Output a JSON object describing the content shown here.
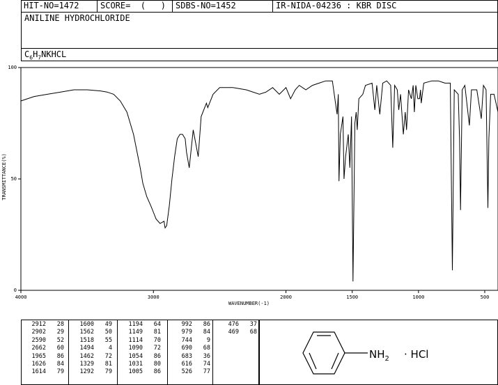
{
  "header": {
    "hit_no": "HIT-NO=1472",
    "score": "SCORE=  (   )",
    "sdbs_no": "SDBS-NO=1452",
    "ir_code": "IR-NIDA-04236 : KBR DISC"
  },
  "compound": {
    "name": "ANILINE HYDROCHLORIDE",
    "formula_prefix": "C",
    "formula_c_count": "6",
    "formula_h": "H",
    "formula_h_count": "7",
    "formula_suffix": "NKHCL"
  },
  "structure": {
    "amine": "NH",
    "amine_sub": "2",
    "salt": "· HCl"
  },
  "chart_data": {
    "type": "line",
    "xlabel": "WAVENUMBER(-1)",
    "ylabel": "TRANSMITTANCE(%)",
    "xlim": [
      4000,
      400
    ],
    "ylim": [
      0,
      100
    ],
    "x_ticks": [
      4000,
      3000,
      2000,
      1500,
      1000,
      500
    ],
    "y_ticks": [
      0,
      50,
      100
    ],
    "x_tick_labels": [
      "4000",
      "3000",
      "2000",
      "1500",
      "1000",
      "500"
    ],
    "y_tick_labels": [
      "0",
      "50",
      "100"
    ],
    "grid": false,
    "series": [
      {
        "points": [
          [
            4000,
            85
          ],
          [
            3900,
            87
          ],
          [
            3800,
            88
          ],
          [
            3700,
            89
          ],
          [
            3600,
            90
          ],
          [
            3500,
            90
          ],
          [
            3400,
            89.5
          ],
          [
            3350,
            89
          ],
          [
            3300,
            88
          ],
          [
            3250,
            85
          ],
          [
            3200,
            80
          ],
          [
            3150,
            70
          ],
          [
            3100,
            55
          ],
          [
            3080,
            48
          ],
          [
            3050,
            42
          ],
          [
            3020,
            38
          ],
          [
            3000,
            35
          ],
          [
            2980,
            32
          ],
          [
            2950,
            30
          ],
          [
            2920,
            31
          ],
          [
            2912,
            28
          ],
          [
            2900,
            29
          ],
          [
            2880,
            38
          ],
          [
            2860,
            50
          ],
          [
            2840,
            60
          ],
          [
            2820,
            68
          ],
          [
            2800,
            70
          ],
          [
            2780,
            70
          ],
          [
            2760,
            68
          ],
          [
            2750,
            62
          ],
          [
            2730,
            55
          ],
          [
            2700,
            72
          ],
          [
            2662,
            60
          ],
          [
            2640,
            78
          ],
          [
            2600,
            84
          ],
          [
            2590,
            82
          ],
          [
            2550,
            88
          ],
          [
            2500,
            91
          ],
          [
            2400,
            91
          ],
          [
            2300,
            90
          ],
          [
            2200,
            88
          ],
          [
            2150,
            89
          ],
          [
            2100,
            91
          ],
          [
            2050,
            88
          ],
          [
            2000,
            91
          ],
          [
            1965,
            86
          ],
          [
            1930,
            90
          ],
          [
            1900,
            92
          ],
          [
            1850,
            90
          ],
          [
            1800,
            92
          ],
          [
            1750,
            93
          ],
          [
            1700,
            94
          ],
          [
            1650,
            94
          ],
          [
            1626,
            84
          ],
          [
            1614,
            79
          ],
          [
            1605,
            88
          ],
          [
            1600,
            49
          ],
          [
            1590,
            70
          ],
          [
            1570,
            78
          ],
          [
            1562,
            50
          ],
          [
            1550,
            60
          ],
          [
            1540,
            65
          ],
          [
            1530,
            70
          ],
          [
            1518,
            55
          ],
          [
            1505,
            78
          ],
          [
            1494,
            4
          ],
          [
            1480,
            75
          ],
          [
            1470,
            80
          ],
          [
            1462,
            72
          ],
          [
            1450,
            86
          ],
          [
            1420,
            88
          ],
          [
            1400,
            92
          ],
          [
            1350,
            93
          ],
          [
            1329,
            81
          ],
          [
            1315,
            92
          ],
          [
            1292,
            79
          ],
          [
            1270,
            93
          ],
          [
            1240,
            94
          ],
          [
            1210,
            92
          ],
          [
            1194,
            64
          ],
          [
            1180,
            92
          ],
          [
            1160,
            90
          ],
          [
            1149,
            81
          ],
          [
            1135,
            88
          ],
          [
            1114,
            70
          ],
          [
            1100,
            80
          ],
          [
            1090,
            72
          ],
          [
            1075,
            90
          ],
          [
            1054,
            86
          ],
          [
            1040,
            92
          ],
          [
            1031,
            80
          ],
          [
            1020,
            92
          ],
          [
            1005,
            86
          ],
          [
            992,
            86
          ],
          [
            985,
            90
          ],
          [
            979,
            84
          ],
          [
            960,
            93
          ],
          [
            900,
            94
          ],
          [
            850,
            94
          ],
          [
            800,
            93
          ],
          [
            760,
            93
          ],
          [
            744,
            9
          ],
          [
            730,
            90
          ],
          [
            700,
            88
          ],
          [
            690,
            68
          ],
          [
            683,
            36
          ],
          [
            670,
            90
          ],
          [
            650,
            92
          ],
          [
            616,
            74
          ],
          [
            600,
            90
          ],
          [
            560,
            90
          ],
          [
            526,
            77
          ],
          [
            510,
            92
          ],
          [
            490,
            90
          ],
          [
            476,
            37
          ],
          [
            469,
            68
          ],
          [
            455,
            88
          ],
          [
            430,
            88
          ],
          [
            400,
            80
          ]
        ]
      }
    ]
  },
  "peak_table": [
    [
      [
        "2912",
        "28"
      ],
      [
        "2902",
        "29"
      ],
      [
        "2590",
        "52"
      ],
      [
        "2662",
        "60"
      ],
      [
        "1965",
        "86"
      ],
      [
        "1626",
        "84"
      ],
      [
        "1614",
        "79"
      ]
    ],
    [
      [
        "1600",
        "49"
      ],
      [
        "1562",
        "50"
      ],
      [
        "1518",
        "55"
      ],
      [
        "1494",
        "4"
      ],
      [
        "1462",
        "72"
      ],
      [
        "1329",
        "81"
      ],
      [
        "1292",
        "79"
      ]
    ],
    [
      [
        "1194",
        "64"
      ],
      [
        "1149",
        "81"
      ],
      [
        "1114",
        "70"
      ],
      [
        "1090",
        "72"
      ],
      [
        "1054",
        "86"
      ],
      [
        "1031",
        "80"
      ],
      [
        "1005",
        "86"
      ]
    ],
    [
      [
        "992",
        "86"
      ],
      [
        "979",
        "84"
      ],
      [
        "744",
        "9"
      ],
      [
        "690",
        "68"
      ],
      [
        "683",
        "36"
      ],
      [
        "616",
        "74"
      ],
      [
        "526",
        "77"
      ]
    ],
    [
      [
        "476",
        "37"
      ],
      [
        "469",
        "68"
      ]
    ]
  ]
}
